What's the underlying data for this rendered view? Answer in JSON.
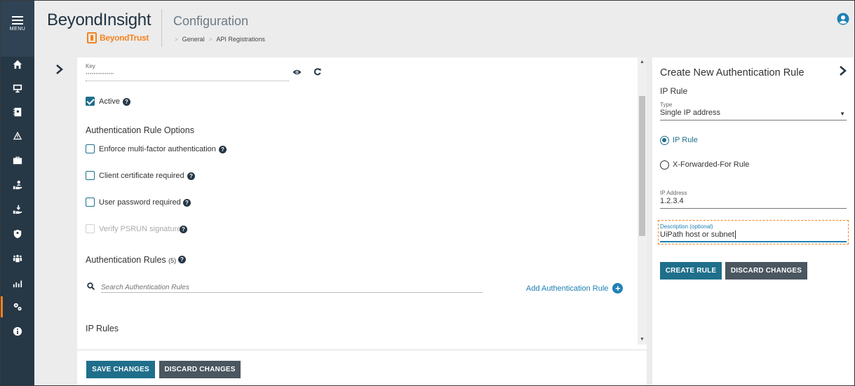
{
  "sidebar": {
    "menu_label": "MENU",
    "items": [
      {
        "name": "home-icon"
      },
      {
        "name": "monitor-icon"
      },
      {
        "name": "address-book-icon"
      },
      {
        "name": "warning-icon"
      },
      {
        "name": "briefcase-icon"
      },
      {
        "name": "hand-user-icon"
      },
      {
        "name": "hand-download-icon"
      },
      {
        "name": "shield-user-icon"
      },
      {
        "name": "users-icon"
      },
      {
        "name": "analytics-icon"
      },
      {
        "name": "cogs-icon",
        "active": true
      },
      {
        "name": "info-icon"
      }
    ],
    "active_color": "#f58220"
  },
  "header": {
    "brand": "BeyondInsight",
    "logo_text": "BeyondTrust",
    "title": "Configuration",
    "breadcrumb": [
      "General",
      "API Registrations"
    ]
  },
  "main": {
    "key": {
      "label": "Key",
      "value": "···············"
    },
    "active": {
      "label": "Active",
      "checked": true
    },
    "options": {
      "title": "Authentication Rule Options",
      "items": [
        {
          "label": "Enforce multi-factor authentication",
          "checked": false,
          "disabled": false
        },
        {
          "label": "Client certificate required",
          "checked": false,
          "disabled": false
        },
        {
          "label": "User password required",
          "checked": false,
          "disabled": false
        },
        {
          "label": "Verify PSRUN signature",
          "checked": false,
          "disabled": true
        }
      ]
    },
    "rules": {
      "title": "Authentication Rules",
      "count": "(5)",
      "search_placeholder": "Search Authentication Rules",
      "add_label": "Add Authentication Rule"
    },
    "ip_rules_title": "IP Rules",
    "footer": {
      "save_label": "SAVE CHANGES",
      "discard_label": "DISCARD CHANGES"
    }
  },
  "panel": {
    "title": "Create New Authentication Rule",
    "subtitle": "IP Rule",
    "type": {
      "label": "Type",
      "value": "Single IP address"
    },
    "radios": [
      {
        "label": "IP Rule",
        "selected": true
      },
      {
        "label": "X-Forwarded-For Rule",
        "selected": false
      }
    ],
    "ip": {
      "label": "IP Address",
      "value": "1.2.3.4"
    },
    "description": {
      "label": "Description (optional)",
      "value": "UiPath host or subnet"
    },
    "create_label": "CREATE RULE",
    "discard_label": "DISCARD CHANGES"
  },
  "colors": {
    "primary": "#1f6f8b",
    "secondary": "#4a5660",
    "brand_orange": "#f58220",
    "sidebar": "#263746",
    "link": "#1f80b5"
  }
}
